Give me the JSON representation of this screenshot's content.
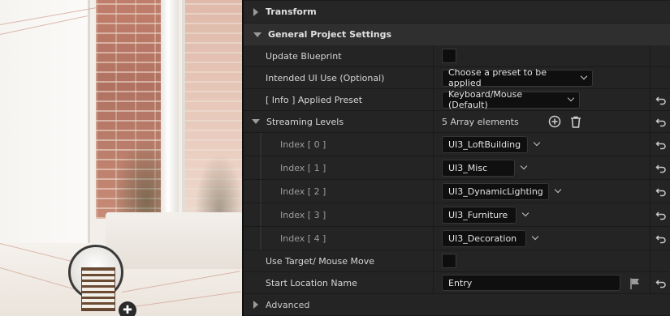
{
  "details": {
    "sections": {
      "transform": "Transform",
      "general": "General Project Settings",
      "advanced": "Advanced"
    },
    "rows": {
      "update_blueprint": "Update Blueprint",
      "intended_ui_use": "Intended UI Use (Optional)",
      "intended_ui_use_value": "Choose a preset to be applied",
      "applied_preset": "[ Info ] Applied Preset",
      "applied_preset_value": "Keyboard/Mouse (Default)",
      "streaming_levels": "Streaming Levels",
      "streaming_levels_count": "5 Array elements",
      "use_target": "Use Target/ Mouse Move",
      "start_location": "Start Location Name",
      "start_location_value": "Entry"
    },
    "streaming_items": [
      {
        "index": "Index [ 0 ]",
        "value": "UI3_LoftBuilding"
      },
      {
        "index": "Index [ 1 ]",
        "value": "UI3_Misc"
      },
      {
        "index": "Index [ 2 ]",
        "value": "UI3_DynamicLighting"
      },
      {
        "index": "Index [ 3 ]",
        "value": "UI3_Furniture"
      },
      {
        "index": "Index [ 4 ]",
        "value": "UI3_Decoration"
      }
    ]
  },
  "icons": {
    "reset": "reset-arrow-icon",
    "add": "add-element-icon",
    "delete": "trash-icon",
    "flag": "flag-icon",
    "chevron": "chevron-down-icon"
  },
  "colors": {
    "panel_bg": "#242424",
    "header_bg": "#2f2f2f",
    "field_bg": "#0f0f0f",
    "text": "#d6d6d6"
  }
}
